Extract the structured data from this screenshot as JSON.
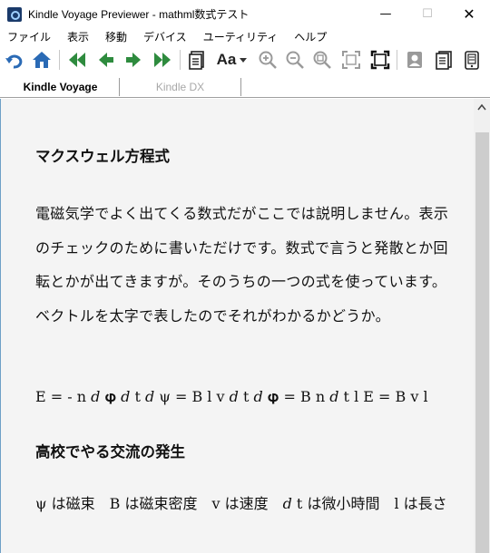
{
  "window": {
    "title": "Kindle Voyage Previewer - mathml数式テスト",
    "minimize": "—",
    "maximize": "☐",
    "close": "✕"
  },
  "menu": [
    "ファイル",
    "表示",
    "移動",
    "デバイス",
    "ユーティリティ",
    "ヘルプ"
  ],
  "toolbar": {
    "font_label": "Aa",
    "icons": [
      "rotate-icon",
      "home-icon",
      "first-page-icon",
      "previous-page-icon",
      "next-page-icon",
      "last-page-icon",
      "document-icon",
      "font-icon",
      "zoom-in-icon",
      "zoom-out-icon",
      "zoom-reset-icon",
      "fit-icon",
      "fullscreen-icon",
      "user-icon",
      "pages-icon",
      "device-icon"
    ]
  },
  "tabs": [
    {
      "label": "Kindle Voyage",
      "active": true
    },
    {
      "label": "Kindle DX",
      "active": false
    }
  ],
  "content": {
    "heading1": "マクスウェル方程式",
    "paragraph1": "電磁気学でよく出てくる数式だがここでは説明しません。表示のチェックのために書いただけです。数式で言うと発散とか回転とかが出てきますが。そのうちの一つの式を使っています。ベクトルを太字で表したのでそれがわかるかどうか。",
    "formula": "E = - n 𝑑 𝛗 𝑑 t 𝑑 ψ = B l v 𝑑 t 𝑑 𝛗 = B n 𝑑 t l E = B v l",
    "heading2": "高校でやる交流の発生",
    "paragraph2": "ψ は磁束　B は磁束密度　v は速度　𝑑 t は微小時間　l は長さ"
  },
  "colors": {
    "accent_blue": "#2a6ab5",
    "nav_green": "#2e8b3e",
    "content_bg": "#f4f4f4"
  }
}
